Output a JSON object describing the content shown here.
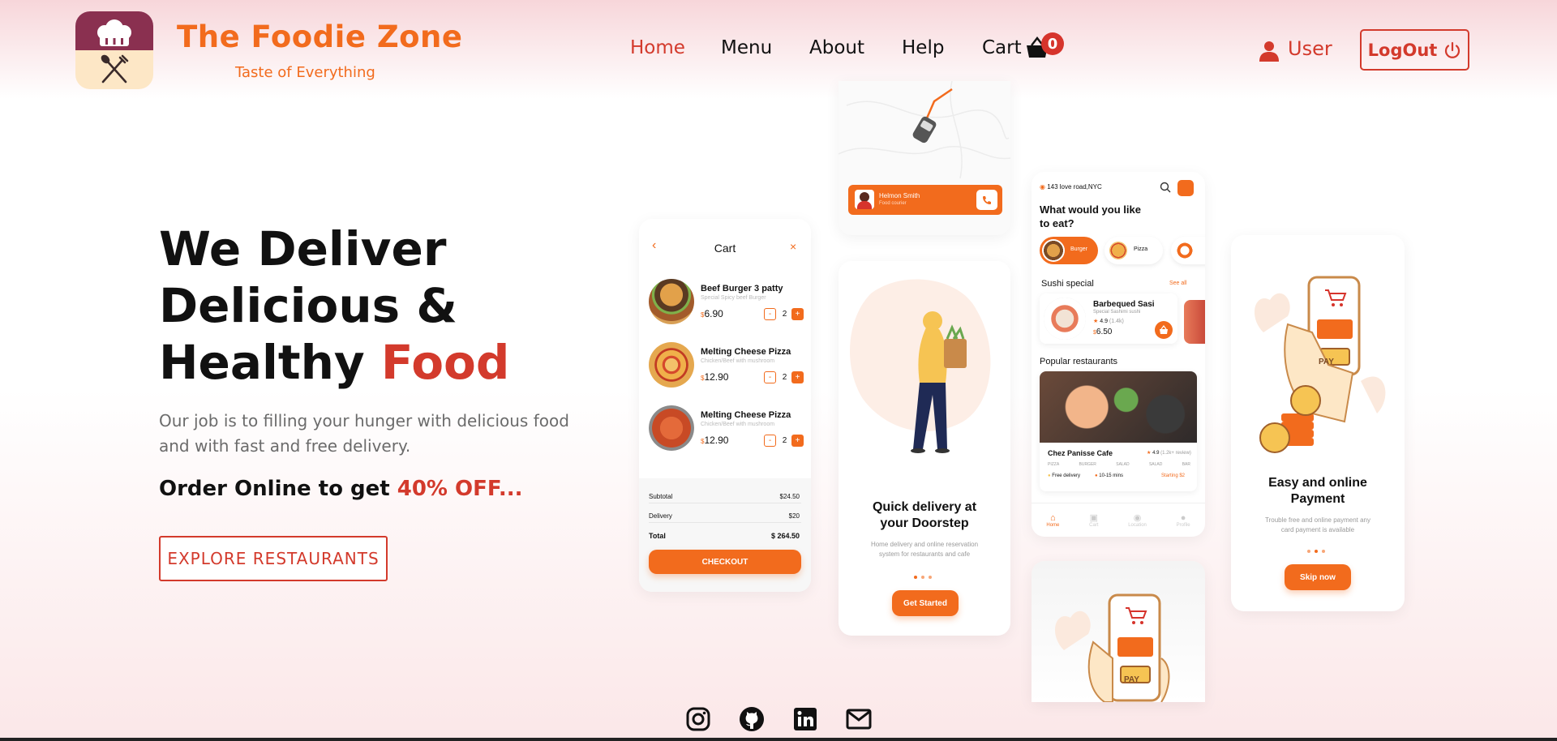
{
  "brand": {
    "name": "The Foodie Zone",
    "tagline": "Taste of Everything"
  },
  "nav": {
    "items": [
      "Home",
      "Menu",
      "About",
      "Help",
      "Cart"
    ],
    "active": "Home",
    "cart_count": "0",
    "user_label": "User",
    "logout_label": "LogOut"
  },
  "hero": {
    "title_line1": "We Deliver",
    "title_line2": "Delicious &",
    "title_line3_plain": "Healthy ",
    "title_line3_accent": "Food",
    "description": "Our job is to filling your hunger with delicious food and with fast and free delivery.",
    "offer_plain": "Order Online to get ",
    "offer_accent": "40% OFF...",
    "cta_label": "EXPLORE RESTAURANTS"
  },
  "phones": {
    "courier": {
      "name": "Helmon Smith",
      "role": "Food courier"
    },
    "cart": {
      "title": "Cart",
      "items": [
        {
          "name": "Beef Burger 3 patty",
          "sub": "Special Spicy beef Burger",
          "price": "6.90",
          "qty": "2"
        },
        {
          "name": "Melting Cheese  Pizza",
          "sub": "Chicken/Beef with mushroom",
          "price": "12.90",
          "qty": "2"
        },
        {
          "name": "Melting Cheese  Pizza",
          "sub": "Chicken/Beef with mushroom",
          "price": "12.90",
          "qty": "2"
        }
      ],
      "subtotal_label": "Subtotal",
      "subtotal": "$24.50",
      "delivery_label": "Delivery",
      "delivery": "$20",
      "total_label": "Total",
      "total": "$ 264.50",
      "checkout_label": "CHECKOUT"
    },
    "delivery": {
      "title": "Quick delivery at your Doorstep",
      "desc": "Home delivery and online reservation system for restaurants and cafe",
      "button": "Get Started"
    },
    "home": {
      "location": "143 love road,NYC",
      "question": "What would you like to eat?",
      "categories": [
        "Burger",
        "Pizza"
      ],
      "sushi_heading": "Sushi special",
      "see_all": "See all",
      "sushi_name": "Barbequed Sasi",
      "sushi_sub": "Special Sashimi sushi",
      "sushi_rating": "4.9",
      "sushi_reviews": "(1.4k)",
      "sushi_price": "6.50",
      "popular_heading": "Popular restaurants",
      "restaurant_name": "Chez Panisse Cafe",
      "restaurant_rating": "4.9",
      "restaurant_reviews": "(1.2k+ review)",
      "restaurant_tags": [
        "PIZZA",
        "BURGER",
        "SALAD",
        "SALAD",
        "BAR"
      ],
      "free_delivery": "Free delivery",
      "eta": "10-15 mins",
      "starting": "Starting $2",
      "tabs": [
        "Home",
        "Cart",
        "Location",
        "Profile"
      ]
    },
    "payment": {
      "title": "Easy and online Payment",
      "desc": "Trouble free and online payment any card payment is available",
      "button": "Skip now",
      "pay_text": "PAY"
    }
  },
  "social": [
    "instagram-icon",
    "github-icon",
    "linkedin-icon",
    "mail-icon"
  ],
  "colors": {
    "brand_orange": "#f26b1d",
    "accent_red": "#d33a2c",
    "logo_purple": "#8a3050"
  }
}
